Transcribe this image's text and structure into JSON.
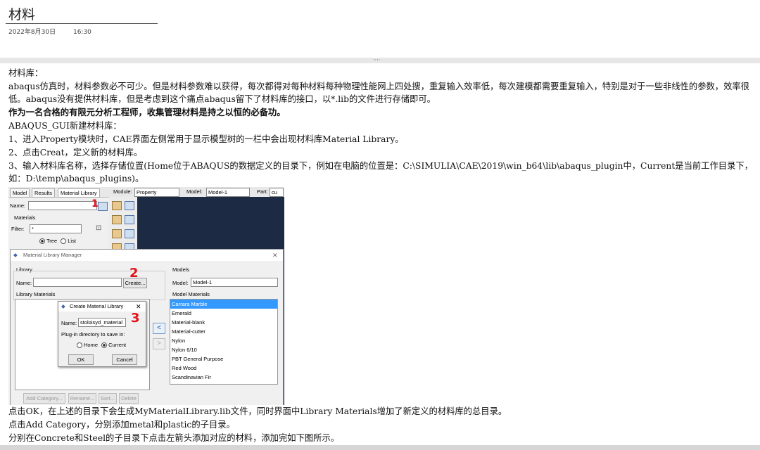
{
  "doc": {
    "title": "材料",
    "date": "2022年8月30日",
    "time": "16:30",
    "splitter_grip": "····"
  },
  "content": {
    "lines": [
      "材料库：",
      "abaqus仿真时，材料参数必不可少。但是材料参数难以获得，每次都得对每种材料每种物理性能网上四处搜，重复输入效率低，每次建模都需要重复输入，特别是对于一些非线性的参数，效率很低。abaqus没有提供材料库，但是考虑到这个痛点abaqus留下了材料库的接口，以*.lib的文件进行存储即可。",
      "作为一名合格的有限元分析工程师，收集管理材料是持之以恒的必备功。",
      "ABAQUS_GUI新建材料库：",
      "1、进入Property模块时，CAE界面左侧常用于显示模型树的一栏中会出现材料库Material Library。",
      "2、点击Creat，定义新的材料库。",
      "3、输入材料库名称，选择存储位置(Home位于ABAQUS的数据定义的目录下，例如在电脑的位置是：C:\\SIMULIA\\CAE\\2019\\win_b64\\lib\\abaqus_plugin中，Current是当前工作目录下，如：D:\\temp\\abaqus_plugins)。"
    ],
    "after_lines": [
      "点击OK，在上述的目录下会生成MyMaterialLibrary.lib文件，同时界面中Library Materials增加了新定义的材料库的总目录。",
      "点击Add Category，分别添加metal和plastic的子目录。",
      "分别在Concrete和Steel的子目录下点击左箭头添加对应的材料，添加完如下图所示。"
    ]
  },
  "screenshot": {
    "tabs": [
      "Model",
      "Results",
      "Material Library"
    ],
    "module_label": "Module:",
    "module_value": "Property",
    "model_label": "Model:",
    "model_value": "Model-1",
    "part_label": "Part:",
    "part_value": "cu",
    "name_label": "Name:",
    "materials_label": "Materials",
    "filter_label": "Filter:",
    "filter_value": "*",
    "tree_label": "Tree",
    "list_label": "List",
    "manager_title": "Material Library Manager",
    "library_label": "Library",
    "lib_name_label": "Name:",
    "create_button": "Create...",
    "library_materials_label": "Library Materials",
    "models_label": "Models",
    "models_model_label": "Model:",
    "models_model_value": "Model-1",
    "model_materials_label": "Model Materials",
    "model_materials": [
      "Carrara Marble",
      "Emerald",
      "Material-blank",
      "Material-cutter",
      "Nylon",
      "Nylon 6/10",
      "PBT General Purpose",
      "Red Wood",
      "Scandinavian Fir"
    ],
    "create_dialog_title": "Create Material Library",
    "create_name_label": "Name:",
    "create_name_value": "stoloisyd_material",
    "plugin_dir_label": "Plug-in directory to save in:",
    "home_label": "Home",
    "current_label": "Current",
    "ok_button": "OK",
    "cancel_button": "Cancel",
    "bottom_buttons": [
      "Add Category...",
      "Rename...",
      "Sort...",
      "Delete"
    ],
    "arrow_left": "<",
    "arrow_right": ">",
    "marks": [
      "1",
      "2",
      "3"
    ]
  },
  "colors": {
    "selection": "#3399ff",
    "viewport": "#1d2a44",
    "annotation_red": "#e0111b"
  }
}
